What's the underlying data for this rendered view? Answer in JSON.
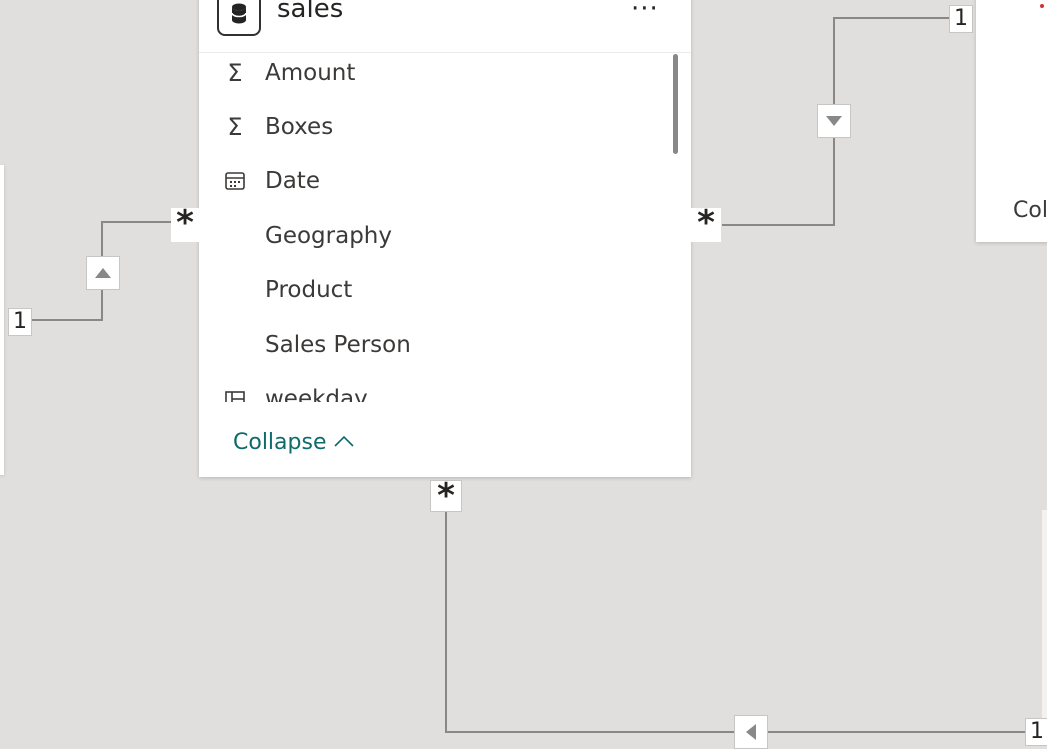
{
  "sales_table": {
    "title": "sales",
    "more_label": "···",
    "fields": [
      {
        "icon": "sigma-icon",
        "glyph": "Σ",
        "label": "Amount"
      },
      {
        "icon": "sigma-icon",
        "glyph": "Σ",
        "label": "Boxes"
      },
      {
        "icon": "calendar-icon",
        "glyph": "",
        "label": "Date"
      },
      {
        "icon": "",
        "glyph": "",
        "label": "Geography"
      },
      {
        "icon": "",
        "glyph": "",
        "label": "Product"
      },
      {
        "icon": "",
        "glyph": "",
        "label": "Sales Person"
      },
      {
        "icon": "hierarchy-icon",
        "glyph": "",
        "label": "weekday"
      }
    ],
    "collapse_label": "Collapse"
  },
  "right_card": {
    "footer_text": "Col"
  },
  "relationships": [
    {
      "from": "left-table",
      "to": "sales",
      "one": "1",
      "many": "*"
    },
    {
      "from": "right-table",
      "to": "sales",
      "one": "1",
      "many": "*"
    },
    {
      "from": "bottom-table",
      "to": "sales",
      "one": "1",
      "many": "*"
    }
  ]
}
